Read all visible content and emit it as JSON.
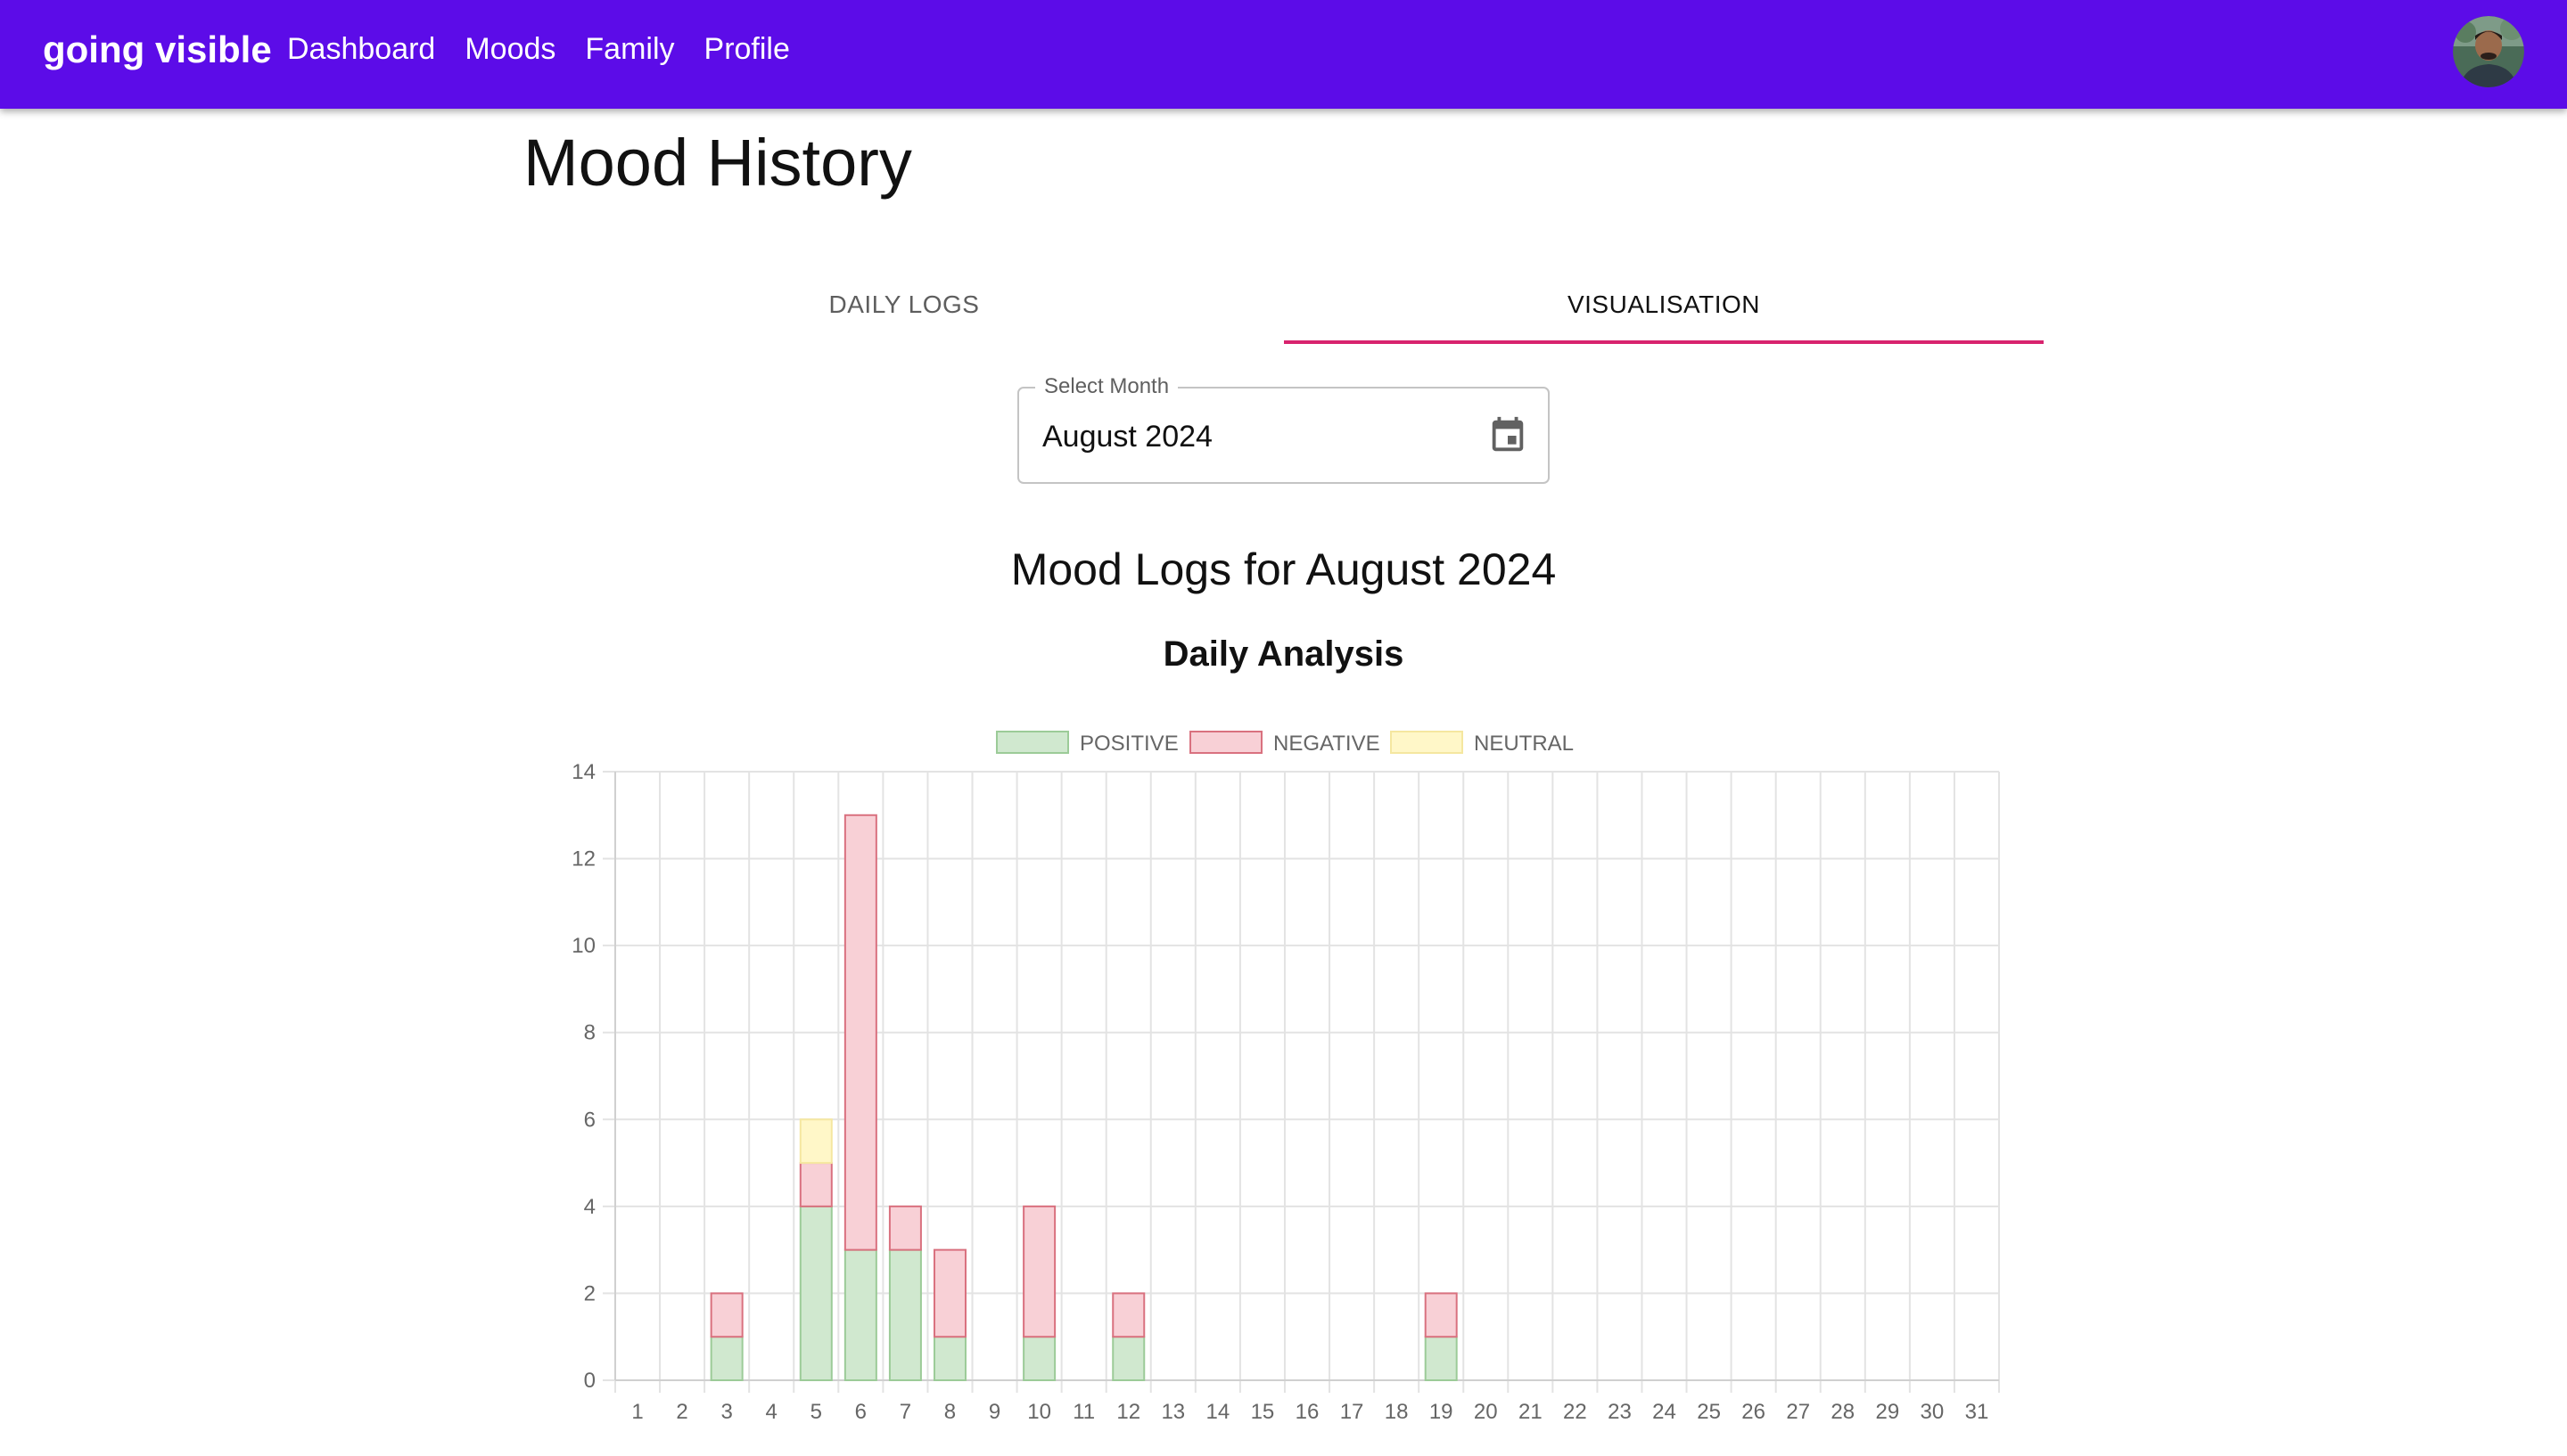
{
  "app": {
    "brand": "going visible",
    "nav": [
      "Dashboard",
      "Moods",
      "Family",
      "Profile"
    ],
    "avatar_icon": "user-avatar"
  },
  "page": {
    "title": "Mood History",
    "tabs": [
      {
        "label": "DAILY LOGS",
        "active": false
      },
      {
        "label": "VISUALISATION",
        "active": true
      }
    ],
    "month_picker": {
      "label": "Select Month",
      "value": "August 2024",
      "icon": "calendar-icon"
    },
    "logs_title": "Mood Logs for August 2024",
    "chart_title": "Daily Analysis"
  },
  "colors": {
    "appbar": "#5c0ce8",
    "tab_indicator": "#d8236e"
  },
  "chart_data": {
    "type": "bar",
    "stacked": true,
    "title": "Daily Analysis",
    "xlabel": "",
    "ylabel": "",
    "ylim": [
      0,
      14
    ],
    "yticks": [
      0,
      2,
      4,
      6,
      8,
      10,
      12,
      14
    ],
    "grid": true,
    "legend_position": "top",
    "categories": [
      "1",
      "2",
      "3",
      "4",
      "5",
      "6",
      "7",
      "8",
      "9",
      "10",
      "11",
      "12",
      "13",
      "14",
      "15",
      "16",
      "17",
      "18",
      "19",
      "20",
      "21",
      "22",
      "23",
      "24",
      "25",
      "26",
      "27",
      "28",
      "29",
      "30",
      "31"
    ],
    "series": [
      {
        "name": "POSITIVE",
        "fill": "#d0e8cf",
        "stroke": "#9ccb98",
        "values": [
          0,
          0,
          1,
          0,
          4,
          3,
          3,
          1,
          0,
          1,
          0,
          1,
          0,
          0,
          0,
          0,
          0,
          0,
          1,
          0,
          0,
          0,
          0,
          0,
          0,
          0,
          0,
          0,
          0,
          0,
          0
        ]
      },
      {
        "name": "NEGATIVE",
        "fill": "#f8d0d6",
        "stroke": "#d9717f",
        "values": [
          0,
          0,
          1,
          0,
          1,
          10,
          1,
          2,
          0,
          3,
          0,
          1,
          0,
          0,
          0,
          0,
          0,
          0,
          1,
          0,
          0,
          0,
          0,
          0,
          0,
          0,
          0,
          0,
          0,
          0,
          0
        ]
      },
      {
        "name": "NEUTRAL",
        "fill": "#fff7c8",
        "stroke": "#f5e7a0",
        "values": [
          0,
          0,
          0,
          0,
          1,
          0,
          0,
          0,
          0,
          0,
          0,
          0,
          0,
          0,
          0,
          0,
          0,
          0,
          0,
          0,
          0,
          0,
          0,
          0,
          0,
          0,
          0,
          0,
          0,
          0,
          0
        ]
      }
    ]
  }
}
